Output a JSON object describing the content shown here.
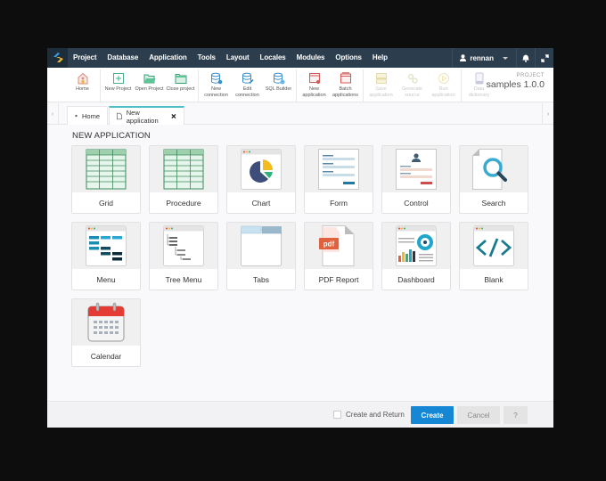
{
  "topbar": {
    "menu": [
      "Project",
      "Database",
      "Application",
      "Tools",
      "Layout",
      "Locales",
      "Modules",
      "Options",
      "Help"
    ],
    "user": "rennan"
  },
  "toolbar": {
    "groups": [
      [
        {
          "label": "Home",
          "icon": "home-icon",
          "disabled": false
        }
      ],
      [
        {
          "label": "New Project",
          "icon": "new-project-icon",
          "disabled": false
        },
        {
          "label": "Open Project",
          "icon": "folder-open-icon",
          "disabled": false
        },
        {
          "label": "Close project",
          "icon": "folder-close-icon",
          "disabled": false
        }
      ],
      [
        {
          "label": "New connection",
          "icon": "database-add-icon",
          "disabled": false
        },
        {
          "label": "Edit connection",
          "icon": "database-edit-icon",
          "disabled": false
        },
        {
          "label": "SQL Builder",
          "icon": "database-sql-icon",
          "disabled": false
        }
      ],
      [
        {
          "label": "New application",
          "icon": "app-new-icon",
          "disabled": false
        },
        {
          "label": "Batch applications",
          "icon": "app-batch-icon",
          "disabled": false
        }
      ],
      [
        {
          "label": "Save application",
          "icon": "save-icon",
          "disabled": true
        },
        {
          "label": "Generate source",
          "icon": "gears-icon",
          "disabled": true
        },
        {
          "label": "Run application",
          "icon": "play-icon",
          "disabled": true
        }
      ],
      [
        {
          "label": "Data dictionary",
          "icon": "dictionary-icon",
          "disabled": true
        }
      ]
    ],
    "project_label": "PROJECT",
    "project_name": "samples 1.0.0"
  },
  "tabs": {
    "home": "Home",
    "active": "New application"
  },
  "content": {
    "heading": "NEW APPLICATION",
    "cards": [
      "Grid",
      "Procedure",
      "Chart",
      "Form",
      "Control",
      "Search",
      "Menu",
      "Tree Menu",
      "Tabs",
      "PDF Report",
      "Dashboard",
      "Blank",
      "Calendar"
    ]
  },
  "footer": {
    "create_return": "Create and Return",
    "create": "Create",
    "cancel": "Cancel",
    "help": "?"
  },
  "colors": {
    "topbar": "#2c3e4e",
    "accent": "#1587d5",
    "tab_active": "#4ac0c8"
  }
}
